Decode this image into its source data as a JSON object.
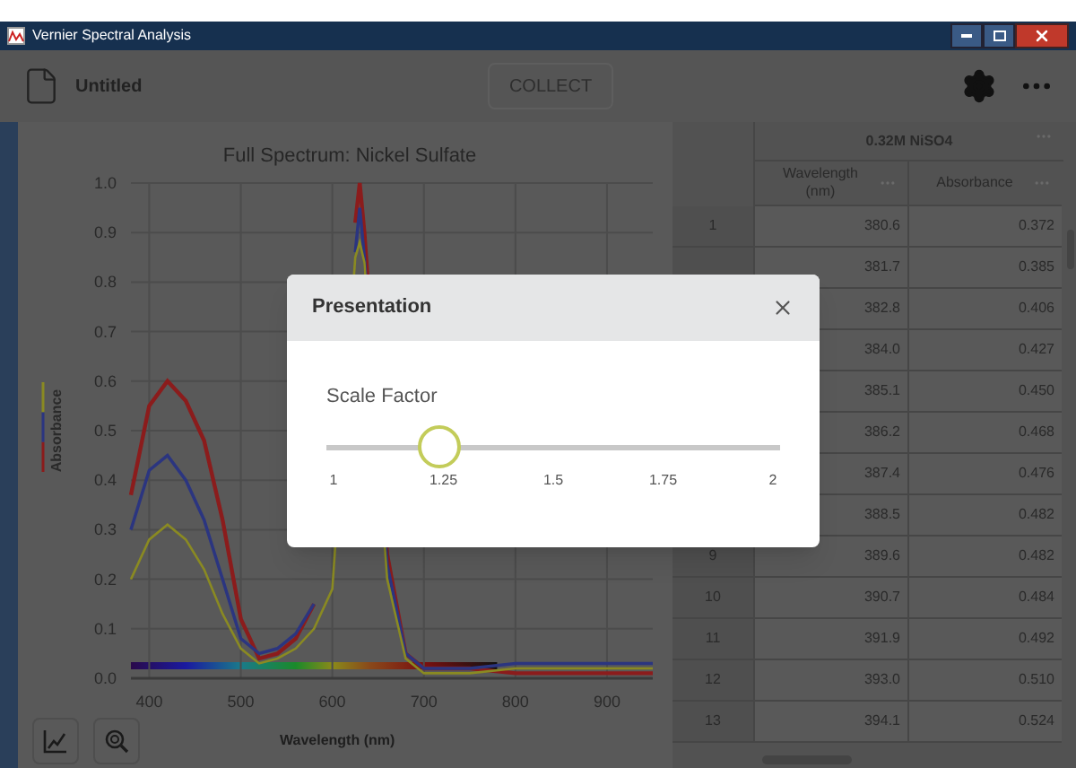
{
  "window": {
    "title": "Vernier Spectral Analysis"
  },
  "toolbar": {
    "file_name": "Untitled",
    "collect_button": {
      "label": "COLLECT",
      "disabled": true
    }
  },
  "graph": {
    "chart_data": {
      "type": "line",
      "title": "Full Spectrum: Nickel Sulfate",
      "xlabel": "Wavelength (nm)",
      "ylabel": "Absorbance",
      "x": [
        380,
        400,
        420,
        440,
        460,
        480,
        500,
        520,
        540,
        560,
        580,
        600,
        625,
        630,
        635,
        660,
        680,
        700,
        750,
        800,
        850,
        900,
        950
      ],
      "series": [
        {
          "color": "#8b1c1c",
          "values": [
            0.37,
            0.55,
            0.6,
            0.56,
            0.48,
            0.32,
            0.12,
            0.04,
            0.05,
            0.08,
            0.15,
            null,
            0.92,
            1.0,
            0.9,
            0.25,
            0.05,
            0.02,
            0.02,
            0.01,
            0.01,
            0.01,
            0.01
          ]
        },
        {
          "color": "#2b3580",
          "values": [
            0.3,
            0.42,
            0.45,
            0.4,
            0.32,
            0.2,
            0.08,
            0.05,
            0.06,
            0.09,
            0.15,
            null,
            0.86,
            0.95,
            0.85,
            0.23,
            0.05,
            0.02,
            0.02,
            0.03,
            0.03,
            0.03,
            0.03
          ]
        },
        {
          "color": "#8a8a22",
          "values": [
            0.2,
            0.28,
            0.31,
            0.28,
            0.22,
            0.13,
            0.06,
            0.03,
            0.04,
            0.06,
            0.1,
            0.18,
            0.85,
            0.88,
            0.84,
            0.2,
            0.04,
            0.01,
            0.01,
            0.02,
            0.02,
            0.02,
            0.02
          ]
        }
      ],
      "xlim": [
        380,
        950
      ],
      "ylim": [
        0,
        1.0
      ],
      "grid": true,
      "xticks": [
        400,
        500,
        600,
        700,
        800,
        900
      ],
      "yticks": [
        {
          "value": 0,
          "label": "0.0"
        },
        {
          "value": 0.1,
          "label": "0.1"
        },
        {
          "value": 0.2,
          "label": "0.2"
        },
        {
          "value": 0.3,
          "label": "0.3"
        },
        {
          "value": 0.4,
          "label": "0.4"
        },
        {
          "value": 0.5,
          "label": "0.5"
        },
        {
          "value": 0.6,
          "label": "0.6"
        },
        {
          "value": 0.7,
          "label": "0.7"
        },
        {
          "value": 0.8,
          "label": "0.8"
        },
        {
          "value": 0.9,
          "label": "0.9"
        },
        {
          "value": 1.0,
          "label": "1.0"
        }
      ]
    }
  },
  "table": {
    "group_title": "0.32M NiSO4",
    "columns": [
      "Wavelength (nm)",
      "Absorbance"
    ],
    "rows": [
      {
        "index": "1",
        "cells": [
          "380.6",
          "0.372"
        ]
      },
      {
        "cells": [
          "381.7",
          "0.385"
        ]
      },
      {
        "cells": [
          "382.8",
          "0.406"
        ]
      },
      {
        "cells": [
          "384.0",
          "0.427"
        ]
      },
      {
        "cells": [
          "385.1",
          "0.450"
        ]
      },
      {
        "cells": [
          "386.2",
          "0.468"
        ]
      },
      {
        "cells": [
          "387.4",
          "0.476"
        ]
      },
      {
        "cells": [
          "388.5",
          "0.482"
        ]
      },
      {
        "index": "9",
        "cells": [
          "389.6",
          "0.482"
        ]
      },
      {
        "index": "10",
        "cells": [
          "390.7",
          "0.484"
        ]
      },
      {
        "index": "11",
        "cells": [
          "391.9",
          "0.492"
        ]
      },
      {
        "index": "12",
        "cells": [
          "393.0",
          "0.510"
        ]
      },
      {
        "index": "13",
        "cells": [
          "394.1",
          "0.524"
        ]
      }
    ]
  },
  "dialog": {
    "title": "Presentation",
    "slider": {
      "label": "Scale Factor",
      "level": 0.25,
      "ticks": [
        "1",
        "1.25",
        "1.5",
        "1.75",
        "2"
      ]
    }
  }
}
